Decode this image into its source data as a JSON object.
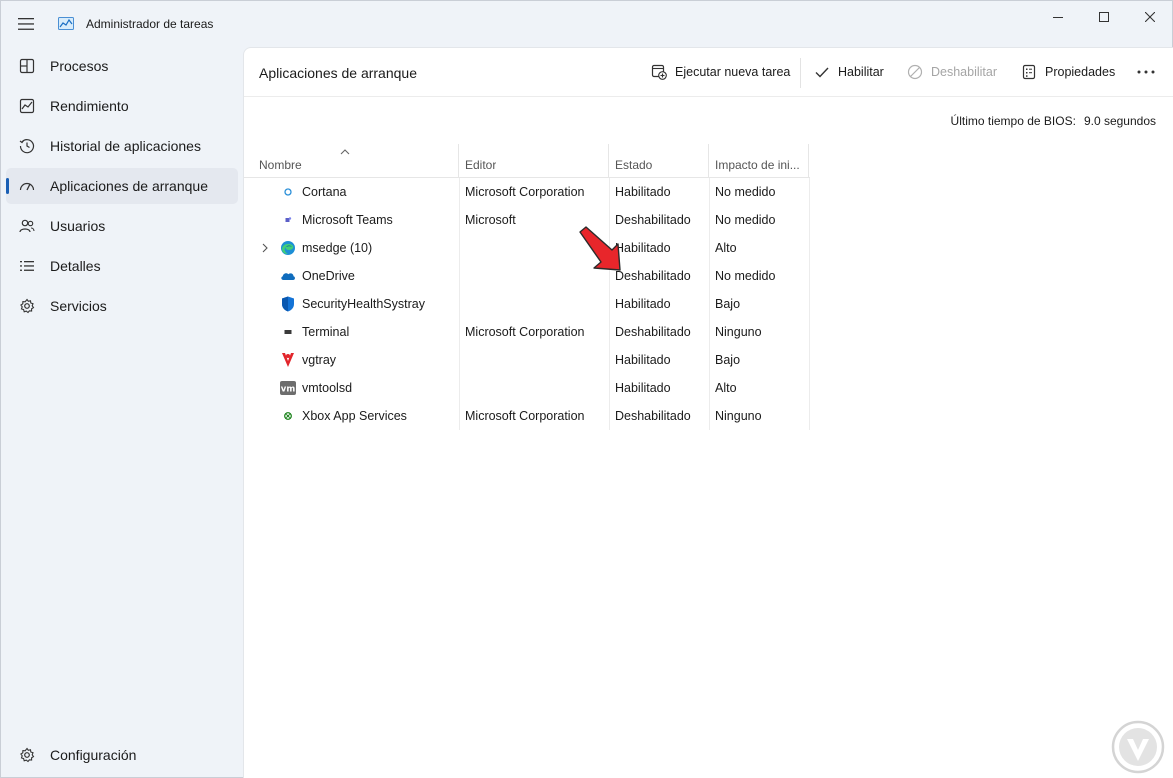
{
  "window": {
    "title": "Administrador de tareas",
    "icons": {
      "menu": "hamburger-menu-icon",
      "app": "task-manager-icon",
      "minimize": "minimize-icon",
      "maximize": "maximize-icon",
      "close": "close-icon"
    }
  },
  "sidebar": {
    "items": [
      {
        "label": "Procesos",
        "icon": "processes-grid-icon"
      },
      {
        "label": "Rendimiento",
        "icon": "performance-chart-icon"
      },
      {
        "label": "Historial de aplicaciones",
        "icon": "history-icon"
      },
      {
        "label": "Aplicaciones de arranque",
        "icon": "startup-speedometer-icon",
        "active": true
      },
      {
        "label": "Usuarios",
        "icon": "users-icon"
      },
      {
        "label": "Detalles",
        "icon": "details-list-icon"
      },
      {
        "label": "Servicios",
        "icon": "services-gear-icon"
      }
    ],
    "settings": {
      "label": "Configuración",
      "icon": "settings-gear-icon"
    }
  },
  "main": {
    "title": "Aplicaciones de arranque",
    "commands": {
      "run_new_task": "Ejecutar nueva tarea",
      "enable": "Habilitar",
      "disable": "Deshabilitar",
      "properties": "Propiedades",
      "more": "more-options-icon"
    },
    "bios": {
      "label": "Último tiempo de BIOS:",
      "value": "9.0 segundos"
    }
  },
  "table": {
    "columns": [
      "Nombre",
      "Editor",
      "Estado",
      "Impacto de ini..."
    ],
    "sort_column": "Nombre",
    "rows": [
      {
        "name": "Cortana",
        "editor": "Microsoft Corporation",
        "state": "Habilitado",
        "impact": "No medido",
        "icon": "cortana-icon"
      },
      {
        "name": "Microsoft Teams",
        "editor": "Microsoft",
        "state": "Deshabilitado",
        "impact": "No medido",
        "icon": "teams-icon"
      },
      {
        "name": "msedge (10)",
        "editor": "",
        "state": "Habilitado",
        "impact": "Alto",
        "icon": "edge-icon",
        "expandable": true
      },
      {
        "name": "OneDrive",
        "editor": "",
        "state": "Deshabilitado",
        "impact": "No medido",
        "icon": "onedrive-cloud-icon"
      },
      {
        "name": "SecurityHealthSystray",
        "editor": "",
        "state": "Habilitado",
        "impact": "Bajo",
        "icon": "security-shield-icon"
      },
      {
        "name": "Terminal",
        "editor": "Microsoft Corporation",
        "state": "Deshabilitado",
        "impact": "Ninguno",
        "icon": "terminal-icon"
      },
      {
        "name": "vgtray",
        "editor": "",
        "state": "Habilitado",
        "impact": "Bajo",
        "icon": "vgtray-icon"
      },
      {
        "name": "vmtoolsd",
        "editor": "",
        "state": "Habilitado",
        "impact": "Alto",
        "icon": "vmware-icon"
      },
      {
        "name": "Xbox App Services",
        "editor": "Microsoft Corporation",
        "state": "Deshabilitado",
        "impact": "Ninguno",
        "icon": "xbox-icon"
      }
    ]
  },
  "colors": {
    "accent": "#1a5fb4",
    "annotation_arrow": "#e8262b",
    "sidebar_bg": "#eff3f8",
    "content_bg": "#ffffff"
  }
}
